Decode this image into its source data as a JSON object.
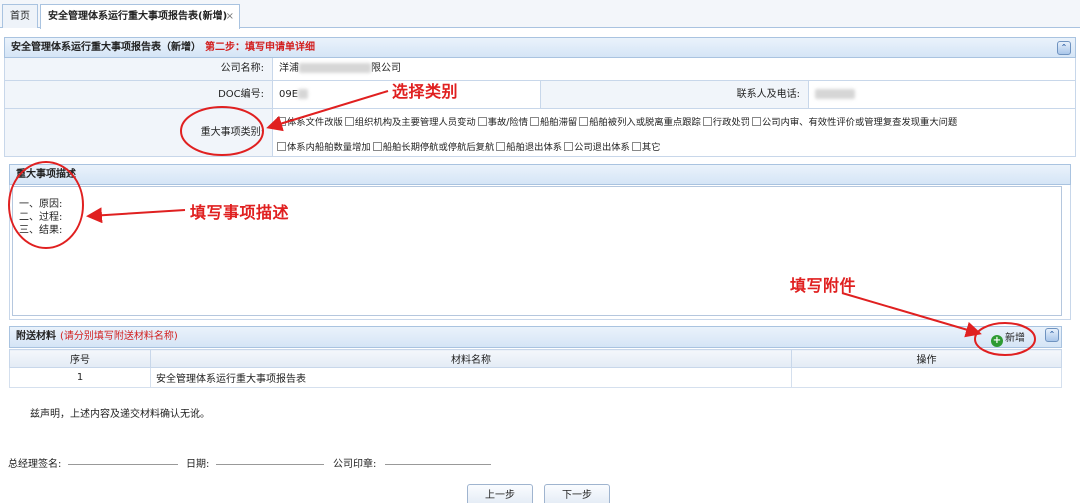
{
  "tabs": {
    "home": "首页",
    "active": "安全管理体系运行重大事项报告表(新增)",
    "close": "×"
  },
  "form": {
    "title": "安全管理体系运行重大事项报告表（新增）",
    "step": "第二步：填写申请单详细",
    "collapse": "⌃",
    "company_label": "公司名称:",
    "company_value_prefix": "洋浦",
    "company_value_suffix": "限公司",
    "doc_label": "DOC编号:",
    "doc_value": "09E",
    "contact_label": "联系人及电话:",
    "category_label": "重大事项类别:",
    "categories_row1": [
      "体系文件改版",
      "组织机构及主要管理人员变动",
      "事故/险情",
      "船舶滞留",
      "船舶被列入或脱离重点跟踪",
      "行政处罚",
      "公司内审、有效性评价或管理复查发现重大问题"
    ],
    "categories_row2": [
      "体系内船舶数量增加",
      "船舶长期停航或停航后复航",
      "船舶退出体系",
      "公司退出体系",
      "其它"
    ]
  },
  "description": {
    "title": "重大事项描述",
    "lines": [
      "一、原因:",
      "二、过程:",
      "三、结果:"
    ]
  },
  "attachments": {
    "title": "附送材料",
    "note": "(请分别填写附送材料名称)",
    "add_label": "新增",
    "columns": [
      "序号",
      "材料名称",
      "操作"
    ],
    "rows": [
      {
        "no": "1",
        "name": "安全管理体系运行重大事项报告表",
        "action": ""
      }
    ]
  },
  "declaration": "兹声明，上述内容及递交材料确认无讹。",
  "signature": {
    "manager": "总经理签名:",
    "date": "日期:",
    "seal": "公司印章:"
  },
  "buttons": {
    "prev": "上一步",
    "next": "下一步"
  },
  "annotations": {
    "select_category": "选择类别",
    "fill_description": "填写事项描述",
    "fill_attachment": "填写附件"
  },
  "colors": {
    "annotation": "#e02020",
    "header_bg": "#d5e5f6",
    "border": "#a9c3e0"
  }
}
